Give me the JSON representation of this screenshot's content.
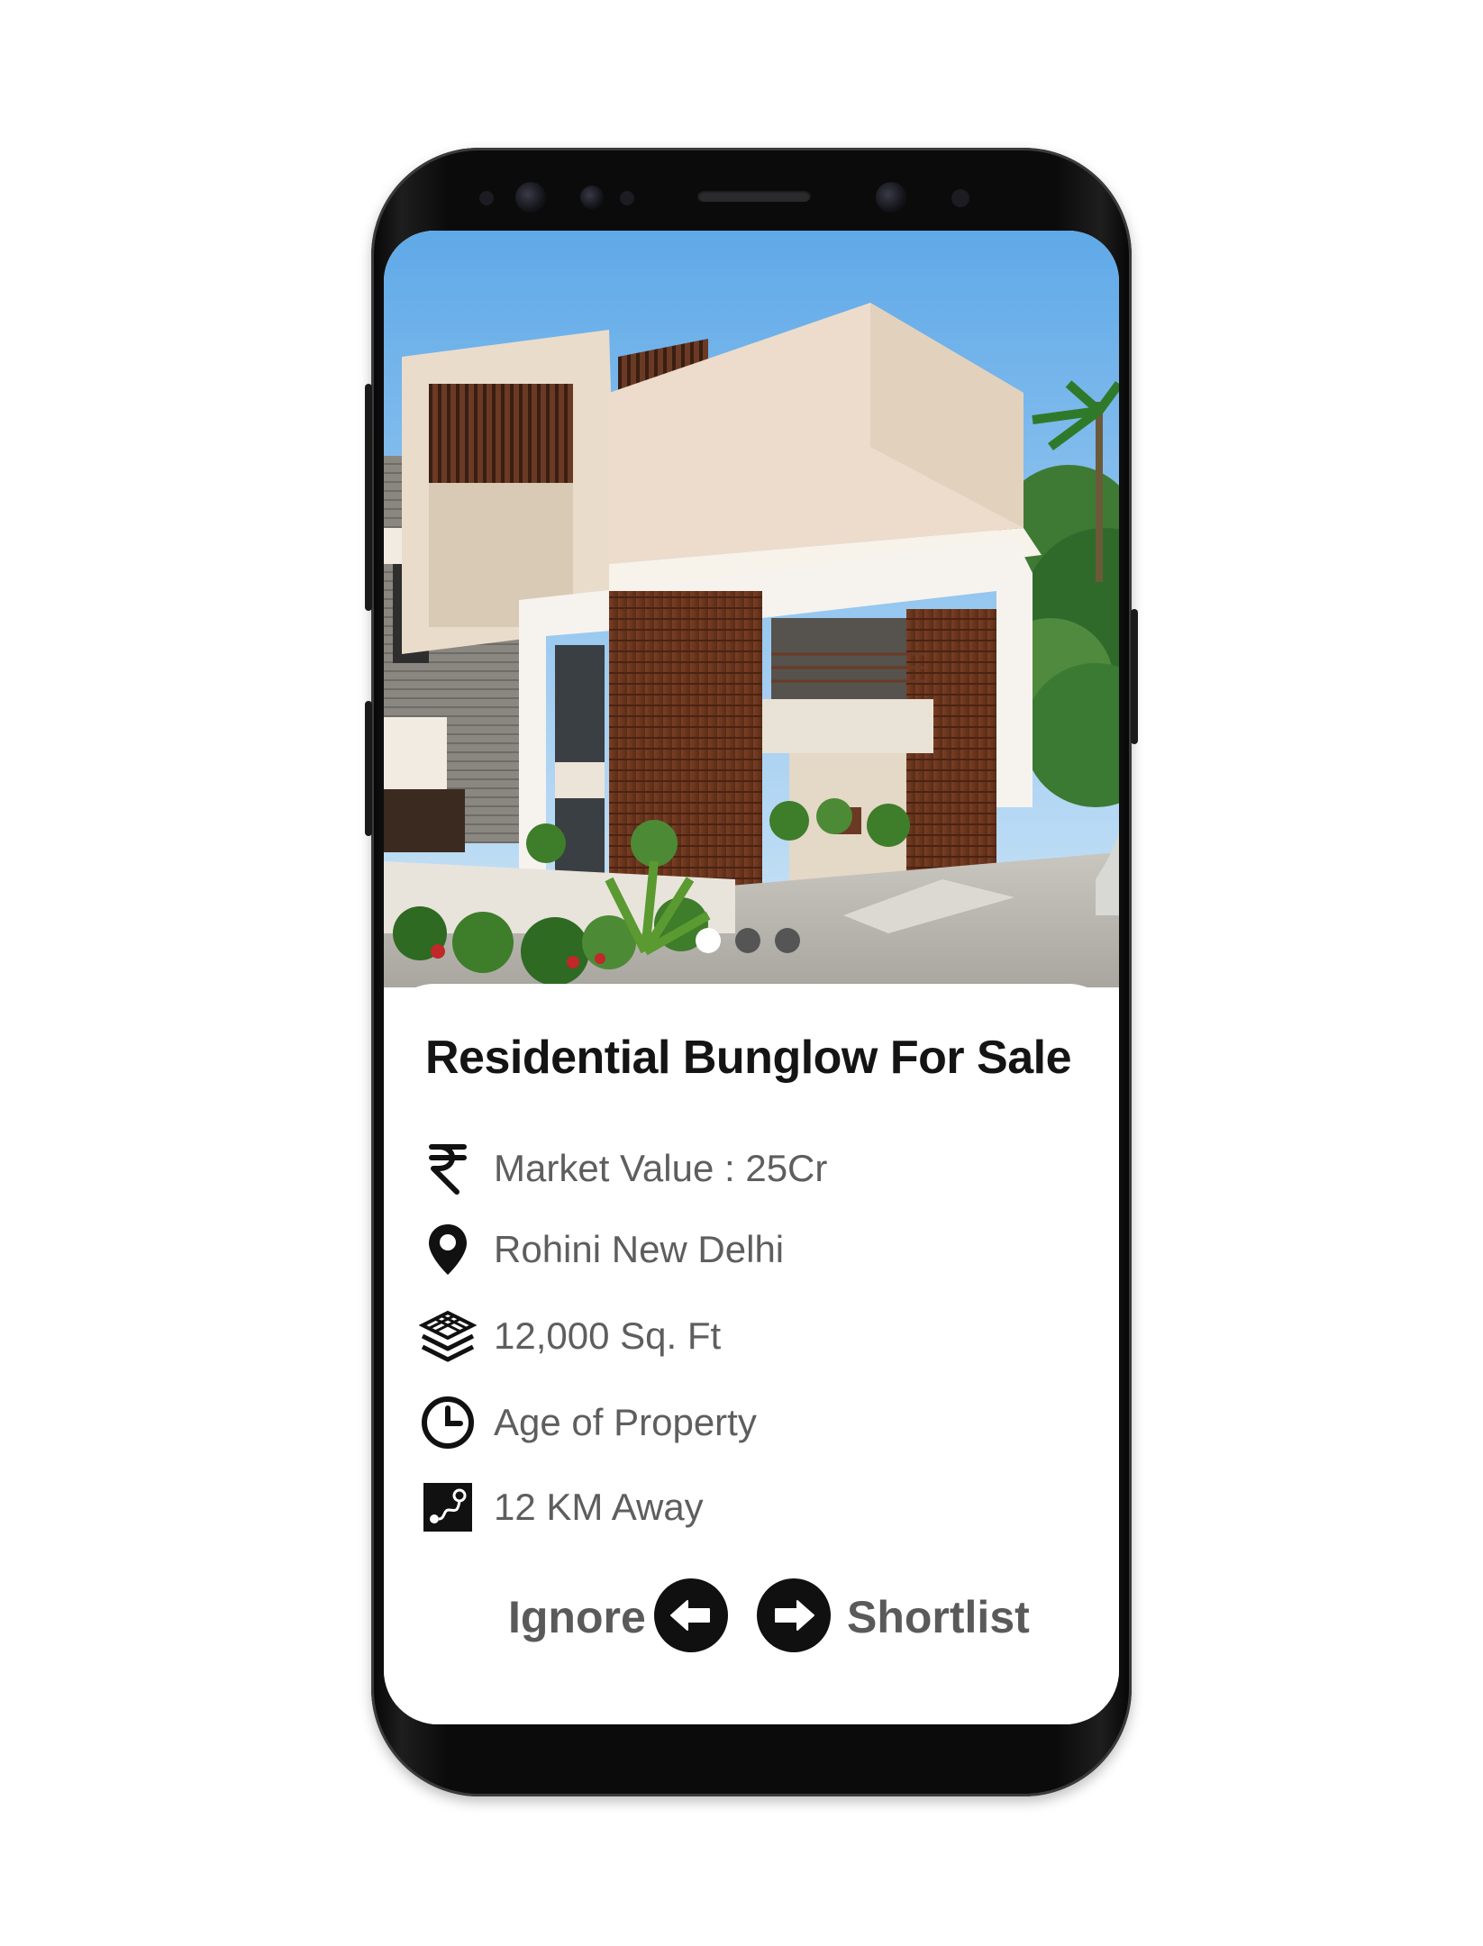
{
  "listing": {
    "title": "Residential Bunglow For Sale",
    "details": [
      {
        "icon": "rupee-icon",
        "text": "Market Value : 25Cr"
      },
      {
        "icon": "location-pin-icon",
        "text": "Rohini New Delhi"
      },
      {
        "icon": "layers-icon",
        "text": "12,000 Sq. Ft"
      },
      {
        "icon": "clock-icon",
        "text": "Age of Property"
      },
      {
        "icon": "route-icon",
        "text": "12 KM Away"
      }
    ]
  },
  "carousel": {
    "total": 3,
    "active": 1
  },
  "actions": {
    "ignore_label": "Ignore",
    "shortlist_label": "Shortlist"
  }
}
